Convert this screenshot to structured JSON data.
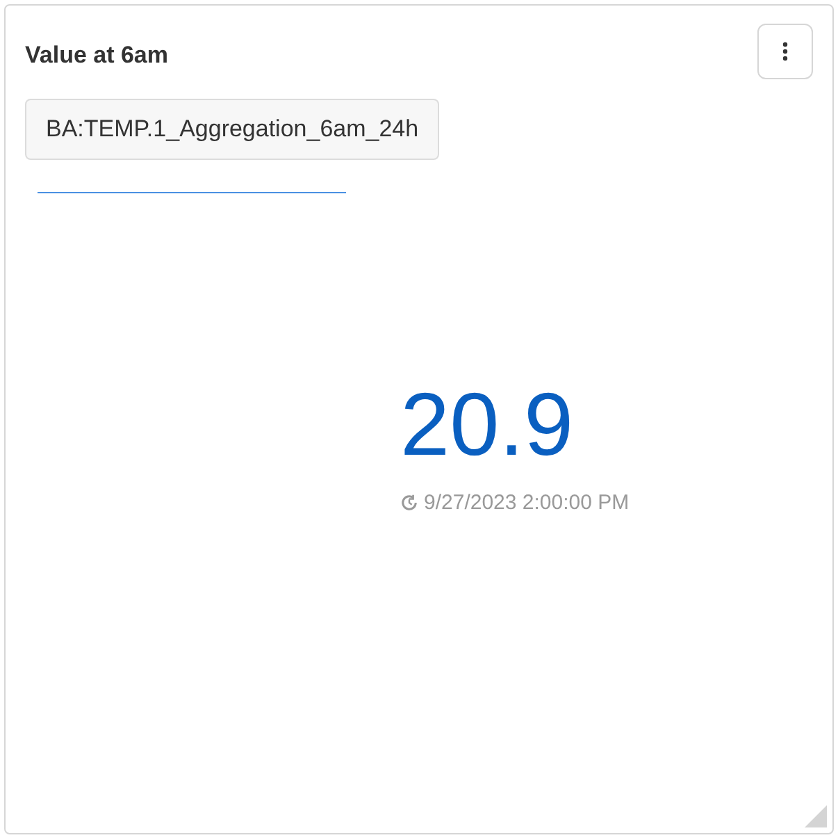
{
  "card": {
    "title": "Value at 6am",
    "tag": "BA:TEMP.1_Aggregation_6am_24h",
    "value": "20.9",
    "timestamp": "9/27/2023 2:00:00 PM"
  }
}
